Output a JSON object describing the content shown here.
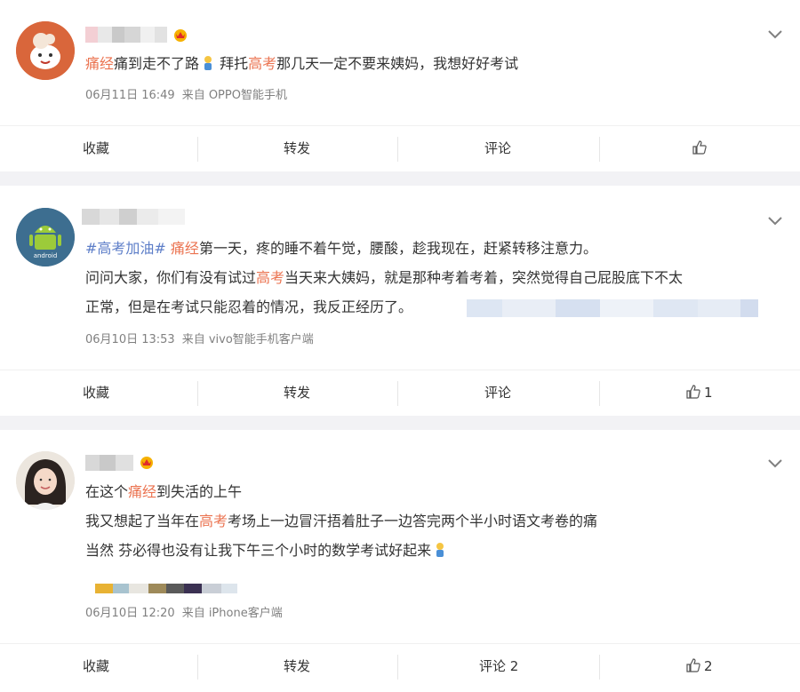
{
  "posts": [
    {
      "segments": [
        {
          "text": "痛经",
          "hl": "red"
        },
        {
          "text": "痛到走不了路",
          "hl": ""
        },
        {
          "text": "拜托",
          "hl": ""
        },
        {
          "text": "高考",
          "hl": "red"
        },
        {
          "text": "那几天一定不要来姨妈，我想好好考试",
          "hl": ""
        }
      ],
      "date": "06月11日 16:49",
      "source": "来自 OPPO智能手机",
      "actions": {
        "fav": "收藏",
        "repost": "转发",
        "comment": "评论",
        "like": ""
      }
    },
    {
      "line1": [
        {
          "text": "#高考加油#",
          "hl": "blue"
        },
        {
          "text": " ",
          "hl": ""
        },
        {
          "text": "痛经",
          "hl": "red"
        },
        {
          "text": "第一天，疼的睡不着午觉，腰酸，趁我现在，赶紧转移注意力。",
          "hl": ""
        }
      ],
      "line2": [
        {
          "text": "问问大家，你们有没有试过",
          "hl": ""
        },
        {
          "text": "高考",
          "hl": "red"
        },
        {
          "text": "当天来大姨妈，就是那种考着考着，突然觉得自己屁股底下不太",
          "hl": ""
        }
      ],
      "line3": "正常，但是在考试只能忍着的情况，我反正经历了。",
      "date": "06月10日 13:53",
      "source": "来自 vivo智能手机客户端",
      "avatar_text": "android",
      "actions": {
        "fav": "收藏",
        "repost": "转发",
        "comment": "评论",
        "like": "1"
      }
    },
    {
      "line1": [
        {
          "text": "在这个",
          "hl": ""
        },
        {
          "text": "痛经",
          "hl": "red"
        },
        {
          "text": "到失活的上午",
          "hl": ""
        }
      ],
      "line2": [
        {
          "text": "我又想起了当年在",
          "hl": ""
        },
        {
          "text": "高考",
          "hl": "red"
        },
        {
          "text": "考场上一边冒汗捂着肚子一边答完两个半小时语文考卷的痛",
          "hl": ""
        }
      ],
      "line3": "当然 芬必得也没有让我下午三个小时的数学考试好起来",
      "date": "06月10日 12:20",
      "source": "来自 iPhone客户端",
      "actions": {
        "fav": "收藏",
        "repost": "转发",
        "comment": "评论 2",
        "like": "2"
      }
    }
  ],
  "colors": {
    "highlight_red": "#eb7350",
    "highlight_blue": "#5d7ec8",
    "meta": "#808080",
    "background": "#f2f2f5"
  },
  "icons": {
    "chevron": "chevron-down-icon",
    "like": "thumbs-up-icon",
    "emoji": "person-emoji-icon",
    "crown": "crown-badge-icon"
  }
}
